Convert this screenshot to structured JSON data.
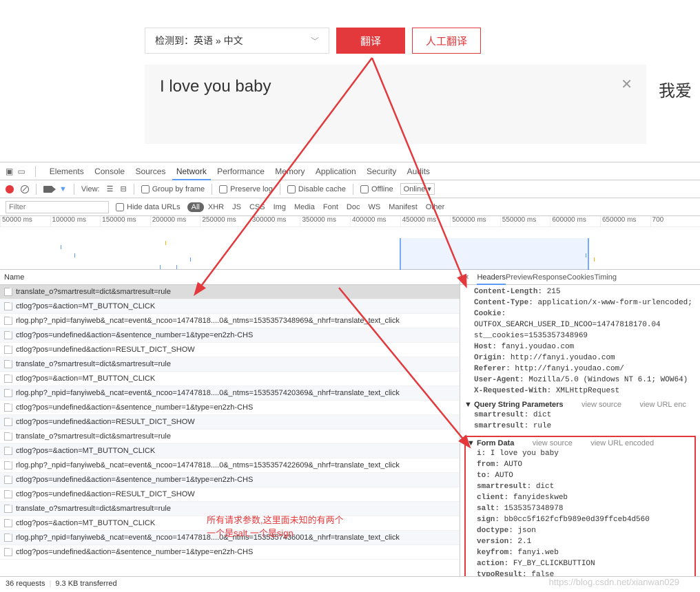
{
  "translator": {
    "lang_text": "检测到：英语 » 中文",
    "translate_btn": "翻译",
    "human_btn": "人工翻译",
    "input_text": "I love you baby",
    "right_text": "我爱"
  },
  "devtools": {
    "tabs": [
      "Elements",
      "Console",
      "Sources",
      "Network",
      "Performance",
      "Memory",
      "Application",
      "Security",
      "Audits"
    ],
    "active_tab": "Network",
    "toolbar": {
      "view_label": "View:",
      "group_label": "Group by frame",
      "preserve_label": "Preserve log",
      "disable_label": "Disable cache",
      "offline_label": "Offline",
      "online_label": "Online"
    },
    "filter": {
      "placeholder": "Filter",
      "hide_data_label": "Hide data URLs",
      "types": [
        "All",
        "XHR",
        "JS",
        "CSS",
        "Img",
        "Media",
        "Font",
        "Doc",
        "WS",
        "Manifest",
        "Other"
      ]
    },
    "timeline_labels": [
      "50000 ms",
      "100000 ms",
      "150000 ms",
      "200000 ms",
      "250000 ms",
      "300000 ms",
      "350000 ms",
      "400000 ms",
      "450000 ms",
      "500000 ms",
      "550000 ms",
      "600000 ms",
      "650000 ms",
      "700"
    ],
    "name_header": "Name",
    "requests": [
      "translate_o?smartresult=dict&smartresult=rule",
      "ctlog?pos=&action=MT_BUTTON_CLICK",
      "rlog.php?_npid=fanyiweb&_ncat=event&_ncoo=14747818....0&_ntms=1535357348969&_nhrf=translate_text_click",
      "ctlog?pos=undefined&action=&sentence_number=1&type=en2zh-CHS",
      "ctlog?pos=undefined&action=RESULT_DICT_SHOW",
      "translate_o?smartresult=dict&smartresult=rule",
      "ctlog?pos=&action=MT_BUTTON_CLICK",
      "rlog.php?_npid=fanyiweb&_ncat=event&_ncoo=14747818....0&_ntms=1535357420369&_nhrf=translate_text_click",
      "ctlog?pos=undefined&action=&sentence_number=1&type=en2zh-CHS",
      "ctlog?pos=undefined&action=RESULT_DICT_SHOW",
      "translate_o?smartresult=dict&smartresult=rule",
      "ctlog?pos=&action=MT_BUTTON_CLICK",
      "rlog.php?_npid=fanyiweb&_ncat=event&_ncoo=14747818....0&_ntms=1535357422609&_nhrf=translate_text_click",
      "ctlog?pos=undefined&action=&sentence_number=1&type=en2zh-CHS",
      "ctlog?pos=undefined&action=RESULT_DICT_SHOW",
      "translate_o?smartresult=dict&smartresult=rule",
      "ctlog?pos=&action=MT_BUTTON_CLICK",
      "rlog.php?_npid=fanyiweb&_ncat=event&_ncoo=14747818....0&_ntms=1535357436001&_nhrf=translate_text_click",
      "ctlog?pos=undefined&action=&sentence_number=1&type=en2zh-CHS"
    ],
    "selected_request_index": 0,
    "detail": {
      "tabs": [
        "Headers",
        "Preview",
        "Response",
        "Cookies",
        "Timing"
      ],
      "active_tab": "Headers",
      "headers": [
        [
          "Content-Length:",
          "215"
        ],
        [
          "Content-Type:",
          "application/x-www-form-urlencoded;"
        ],
        [
          "Cookie:",
          "OUTFOX_SEARCH_USER_ID_NCOO=14747818170.04"
        ],
        [
          "",
          "st__cookies=1535357348969"
        ],
        [
          "Host:",
          "fanyi.youdao.com"
        ],
        [
          "Origin:",
          "http://fanyi.youdao.com"
        ],
        [
          "Referer:",
          "http://fanyi.youdao.com/"
        ],
        [
          "User-Agent:",
          "Mozilla/5.0 (Windows NT 6.1; WOW64)"
        ],
        [
          "X-Requested-With:",
          "XMLHttpRequest"
        ]
      ],
      "qsp_title": "Query String Parameters",
      "view_source": "view source",
      "view_url_enc": "view URL enc",
      "qsp": [
        [
          "smartresult:",
          "dict"
        ],
        [
          "smartresult:",
          "rule"
        ]
      ],
      "formdata_title": "Form Data",
      "view_url_encoded": "view URL encoded",
      "formdata": [
        [
          "i:",
          "I love you baby"
        ],
        [
          "from:",
          "AUTO"
        ],
        [
          "to:",
          "AUTO"
        ],
        [
          "smartresult:",
          "dict"
        ],
        [
          "client:",
          "fanyideskweb"
        ],
        [
          "salt:",
          "1535357348978"
        ],
        [
          "sign:",
          "bb0cc5f162fcfb989e0d39ffceb4d560"
        ],
        [
          "doctype:",
          "json"
        ],
        [
          "version:",
          "2.1"
        ],
        [
          "keyfrom:",
          "fanyi.web"
        ],
        [
          "action:",
          "FY_BY_CLICKBUTTION"
        ],
        [
          "typoResult:",
          "false"
        ]
      ]
    },
    "status": {
      "requests": "36 requests",
      "transferred": "9.3 KB transferred"
    }
  },
  "annotations": {
    "note": "所有请求参数,这里面未知的有两个\n一个是salt,一个是sign"
  },
  "watermark": "https://blog.csdn.net/xianwan029"
}
